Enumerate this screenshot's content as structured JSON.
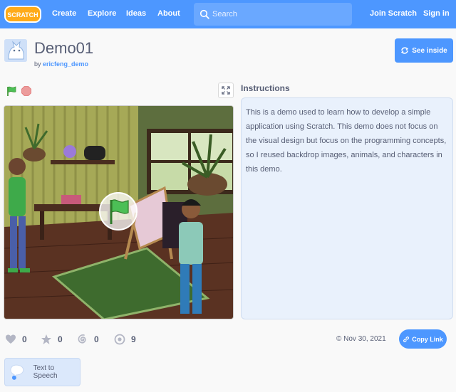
{
  "nav": {
    "logo_text": "SCRATCH",
    "links": [
      "Create",
      "Explore",
      "Ideas",
      "About"
    ],
    "search_placeholder": "Search",
    "join": "Join Scratch",
    "sign_in": "Sign in",
    "color": "#4d97ff"
  },
  "project": {
    "title": "Demo01",
    "by_prefix": "by",
    "author": "ericfeng_demo",
    "see_inside": "See inside"
  },
  "player": {
    "flag_icon": "green-flag-icon",
    "stop_icon": "stop-icon",
    "fullscreen_icon": "fullscreen-icon"
  },
  "instructions": {
    "heading": "Instructions",
    "text": "This is a demo used to learn how to develop a simple application using Scratch. This demo does not focus on the visual design but focus on the programming concepts, so I reused backdrop images, animals, and characters in this demo."
  },
  "stats": {
    "loves": "0",
    "favorites": "0",
    "remixes": "0",
    "views": "9"
  },
  "date": "© Nov 30, 2021",
  "copy_link": "Copy Link",
  "extension": {
    "label": "Text to Speech"
  }
}
